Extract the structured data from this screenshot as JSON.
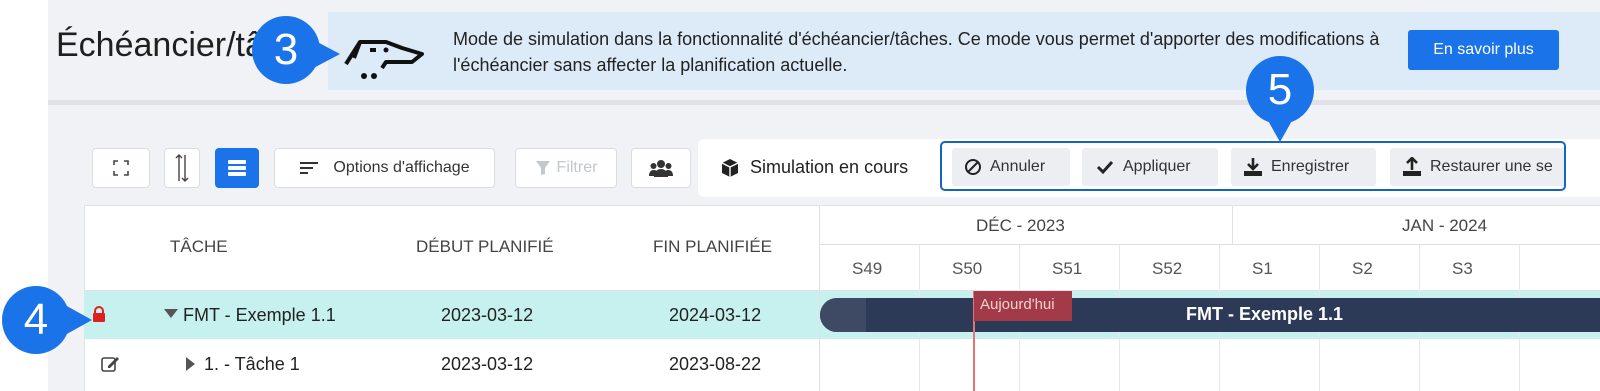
{
  "header": {
    "title": "Échéancier/tâ"
  },
  "banner": {
    "text": "Mode de simulation dans la fonctionnalité d'échéancier/tâches. Ce mode vous permet d'apporter des modifications à l'échéancier sans affecter la planification actuelle.",
    "button_label": "En savoir plus",
    "icon": "dog-simulation-icon"
  },
  "callouts": [
    "3",
    "4",
    "5"
  ],
  "toolbar": {
    "display_options_label": "Options d'affichage",
    "filter_label": "Filtrer",
    "simulation_label": "Simulation en cours",
    "cancel_label": "Annuler",
    "apply_label": "Appliquer",
    "save_label": "Enregistrer",
    "restore_label": "Restaurer une se"
  },
  "table": {
    "columns": [
      "TÂCHE",
      "DÉBUT PLANIFIÉ",
      "FIN PLANIFIÉE"
    ],
    "rows": [
      {
        "name": "FMT - Exemple 1.1",
        "start": "2023-03-12",
        "end": "2024-03-12"
      },
      {
        "name": "1. - Tâche 1",
        "start": "2023-03-12",
        "end": "2023-08-22"
      }
    ]
  },
  "timeline": {
    "months": [
      "DÉC - 2023",
      "JAN - 2024"
    ],
    "weeks": [
      "S49",
      "S50",
      "S51",
      "S52",
      "S1",
      "S2",
      "S3"
    ],
    "today_label": "Aujourd'hui",
    "bar_label": "FMT - Exemple 1.1"
  },
  "colors": {
    "accent": "#1a73e8",
    "selected_row": "#c7f1ee",
    "gantt_bar": "#2c3a57",
    "today_line": "#e57373",
    "lock": "#e02020"
  }
}
